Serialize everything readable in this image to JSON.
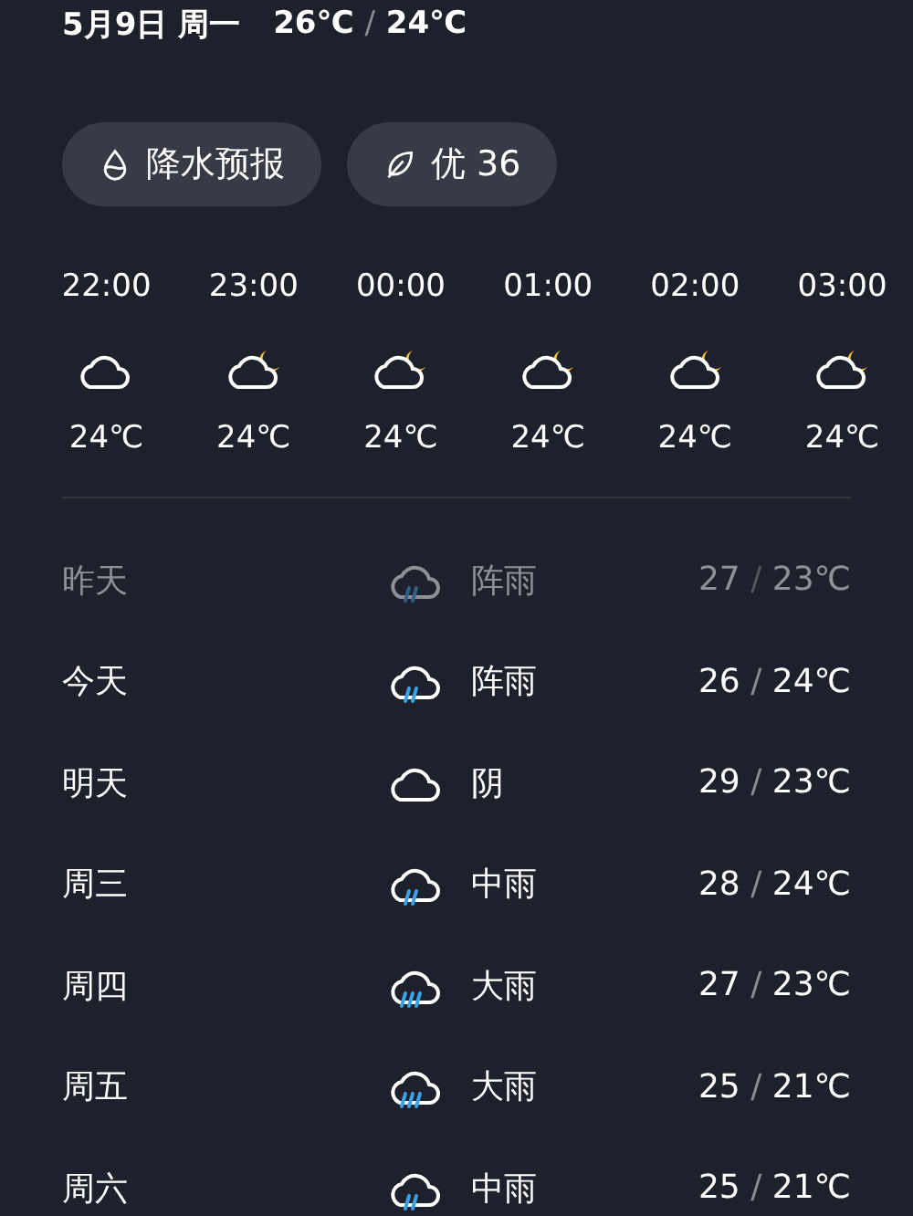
{
  "header": {
    "date": "5月9日 周一",
    "high": "26℃",
    "separator": "/",
    "low": "24℃"
  },
  "chips": [
    {
      "kind": "drop",
      "label": "降水预报"
    },
    {
      "kind": "leaf",
      "label": "优 36"
    }
  ],
  "hourly": [
    {
      "time": "22:00",
      "kind": "cloudy",
      "temp": "24℃"
    },
    {
      "time": "23:00",
      "kind": "night",
      "temp": "24℃"
    },
    {
      "time": "00:00",
      "kind": "night",
      "temp": "24℃"
    },
    {
      "time": "01:00",
      "kind": "night",
      "temp": "24℃"
    },
    {
      "time": "02:00",
      "kind": "night",
      "temp": "24℃"
    },
    {
      "time": "03:00",
      "kind": "night",
      "temp": "24℃"
    }
  ],
  "daily": [
    {
      "day": "昨天",
      "kind": "rain",
      "condition": "阵雨",
      "high": "27",
      "separator": "/",
      "low": "23℃",
      "dimmed": true
    },
    {
      "day": "今天",
      "kind": "rain",
      "condition": "阵雨",
      "high": "26",
      "separator": "/",
      "low": "24℃",
      "dimmed": false
    },
    {
      "day": "明天",
      "kind": "overcast",
      "condition": "阴",
      "high": "29",
      "separator": "/",
      "low": "23℃",
      "dimmed": false
    },
    {
      "day": "周三",
      "kind": "rain",
      "condition": "中雨",
      "high": "28",
      "separator": "/",
      "low": "24℃",
      "dimmed": false
    },
    {
      "day": "周四",
      "kind": "downpour",
      "condition": "大雨",
      "high": "27",
      "separator": "/",
      "low": "23℃",
      "dimmed": false
    },
    {
      "day": "周五",
      "kind": "downpour",
      "condition": "大雨",
      "high": "25",
      "separator": "/",
      "low": "21℃",
      "dimmed": false
    },
    {
      "day": "周六",
      "kind": "rain",
      "condition": "中雨",
      "high": "25",
      "separator": "/",
      "low": "21℃",
      "dimmed": false
    }
  ]
}
